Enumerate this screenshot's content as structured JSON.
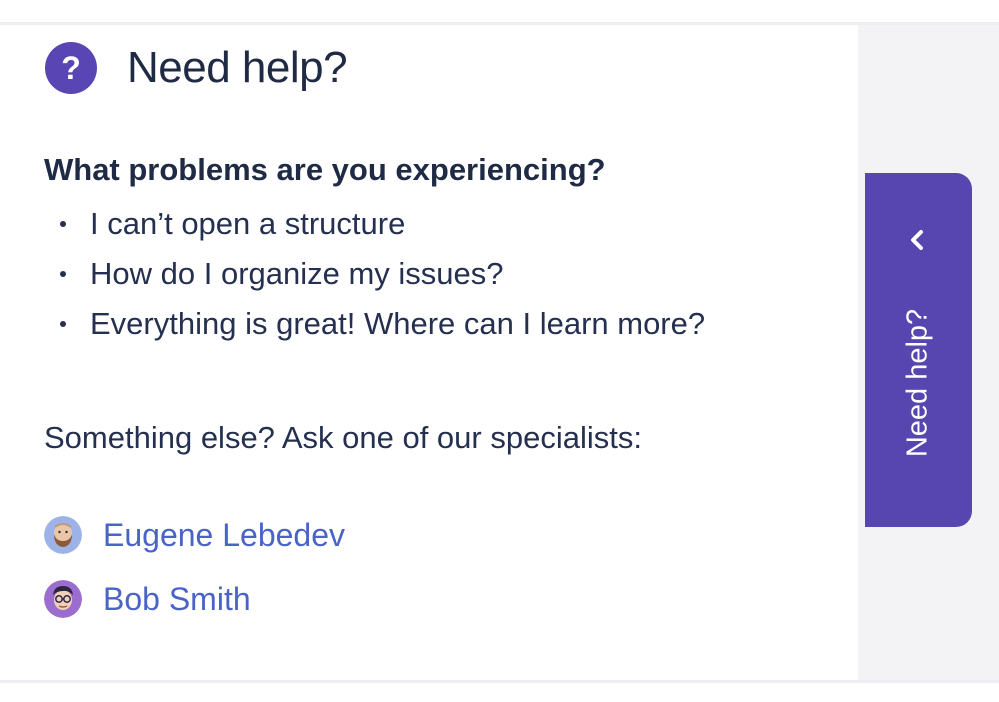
{
  "panel": {
    "title": "Need help?",
    "help_icon_glyph": "?",
    "question": "What problems are you experiencing?",
    "problems": [
      {
        "label": "I can’t open a structure"
      },
      {
        "label": "How do I organize my issues?"
      },
      {
        "label": "Everything is great! Where can I learn more?"
      }
    ],
    "ask_text": "Something else? Ask one of our specialists:",
    "specialists": [
      {
        "name": "Eugene Lebedev",
        "avatar": "bearded-man-avatar"
      },
      {
        "name": "Bob Smith",
        "avatar": "man-with-glasses-avatar"
      }
    ]
  },
  "tab": {
    "label": "Need help?",
    "icon": "chevron-left-icon"
  },
  "colors": {
    "accent": "#5745b0",
    "link": "#4a63c7",
    "text": "#253050",
    "side_bg": "#f3f3f6"
  }
}
